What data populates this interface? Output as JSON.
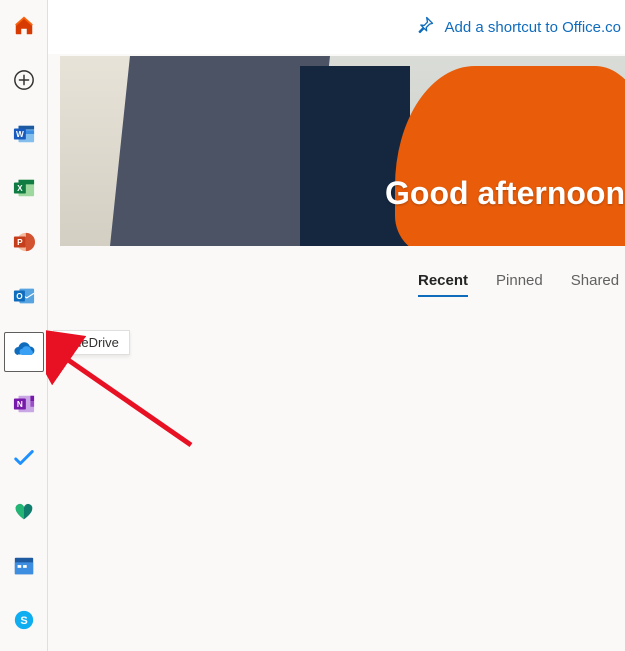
{
  "topbar": {
    "shortcut_label": "Add a shortcut to Office.co"
  },
  "hero": {
    "greeting": "Good afternoon"
  },
  "tabs": {
    "items": [
      {
        "label": "Recent",
        "active": true
      },
      {
        "label": "Pinned",
        "active": false
      },
      {
        "label": "Shared",
        "active": false
      }
    ]
  },
  "sidebar": {
    "items": [
      {
        "name": "home",
        "tooltip": "Home"
      },
      {
        "name": "create",
        "tooltip": "Create"
      },
      {
        "name": "word",
        "tooltip": "Word"
      },
      {
        "name": "excel",
        "tooltip": "Excel"
      },
      {
        "name": "powerpoint",
        "tooltip": "PowerPoint"
      },
      {
        "name": "outlook",
        "tooltip": "Outlook"
      },
      {
        "name": "onedrive",
        "tooltip": "OneDrive",
        "selected": true
      },
      {
        "name": "onenote",
        "tooltip": "OneNote"
      },
      {
        "name": "todo",
        "tooltip": "To Do"
      },
      {
        "name": "family",
        "tooltip": "Family Safety"
      },
      {
        "name": "calendar",
        "tooltip": "Calendar"
      },
      {
        "name": "skype",
        "tooltip": "Skype"
      }
    ]
  },
  "tooltip_visible": "OneDrive"
}
